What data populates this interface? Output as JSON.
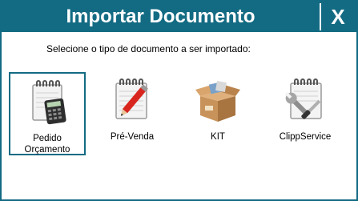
{
  "window": {
    "title": "Importar Documento",
    "close_label": "X"
  },
  "instruction": "Selecione o tipo de documento a ser importado:",
  "options": [
    {
      "label_line1": "Pedido",
      "label_line2": "Orçamento",
      "icon": "notepad-calculator-icon",
      "selected": true
    },
    {
      "label_line1": "Pré-Venda",
      "icon": "notepad-pencil-icon",
      "selected": false
    },
    {
      "label_line1": "KIT",
      "icon": "box-icon",
      "selected": false
    },
    {
      "label_line1": "ClippService",
      "icon": "notepad-wrench-icon",
      "selected": false
    }
  ],
  "colors": {
    "accent": "#136b83",
    "background": "#ffffff"
  }
}
